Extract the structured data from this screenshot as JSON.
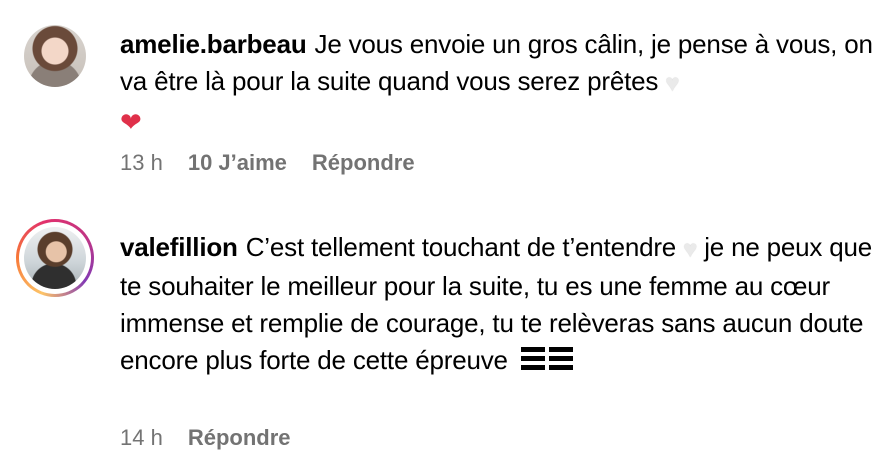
{
  "comments": [
    {
      "username": "amelie.barbeau",
      "text": "Je vous envoie un gros câlin, je pense à vous, on va être là pour la suite quand vous serez prêtes",
      "emojis": [
        "white-heart",
        "mending-heart"
      ],
      "time": "13 h",
      "likes_label": "10 J’aime",
      "reply_label": "Répondre",
      "has_story_ring": false
    },
    {
      "username": "valefillion",
      "text_part1": "C’est tellement touchant de t’entendre",
      "text_part2": "je ne peux que te souhaiter le meilleur pour la suite, tu es une femme au cœur immense et remplie de courage, tu te relèveras sans aucun doute encore plus forte de cette épreuve",
      "emojis": [
        "white-heart",
        "bar-chart-glyph"
      ],
      "time": "14 h",
      "reply_label": "Répondre",
      "has_story_ring": true
    }
  ],
  "colors": {
    "meta_text": "#737373",
    "story_ring_start": "#fdc468",
    "story_ring_end": "#833ab4"
  }
}
